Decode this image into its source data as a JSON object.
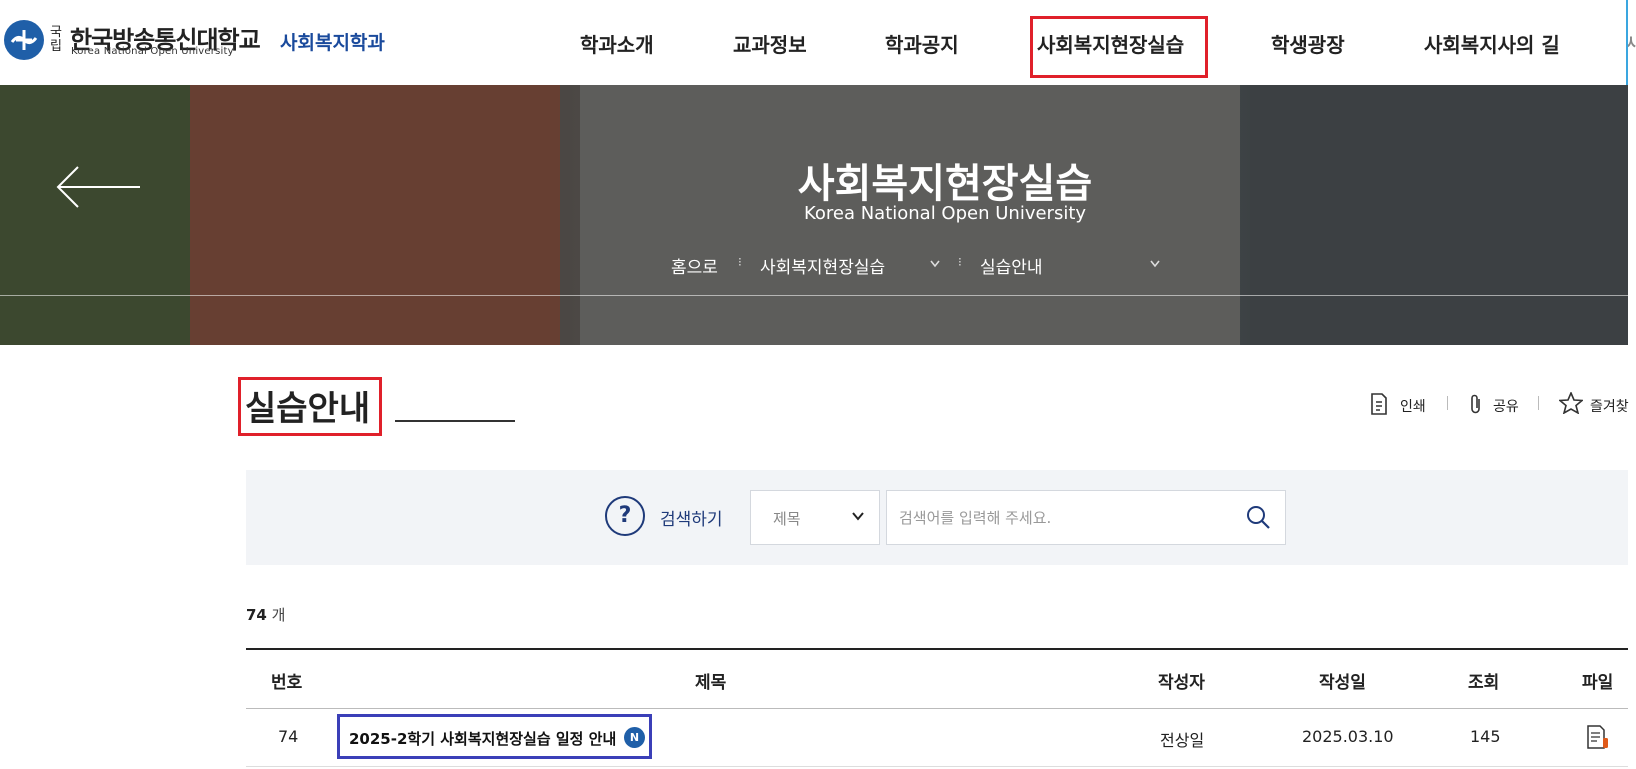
{
  "header": {
    "logo_gukrip": "국립",
    "logo_kr": "한국방송통신대학교",
    "logo_en": "Korea National Open University",
    "dept": "사회복지학과",
    "nav": [
      "학과소개",
      "교과정보",
      "학과공지",
      "사회복지현장실습",
      "학생광장",
      "사회복지사의 길"
    ],
    "nav_cut": "사"
  },
  "hero": {
    "title": "사회복지현장실습",
    "subtitle": "Korea National Open University",
    "breadcrumb": [
      "홈으로",
      "사회복지현장실습",
      "실습안내"
    ]
  },
  "page": {
    "title": "실습안내",
    "tools": {
      "print": "인쇄",
      "share": "공유",
      "favorite": "즐겨찾"
    }
  },
  "search": {
    "label": "검색하기",
    "help_symbol": "?",
    "select_value": "제목",
    "placeholder": "검색어를 입력해 주세요."
  },
  "list": {
    "count_num": "74",
    "count_unit": " 개",
    "columns": [
      "번호",
      "제목",
      "작성자",
      "작성일",
      "조회",
      "파일"
    ],
    "rows": [
      {
        "no": "74",
        "title": "2025-2학기 사회복지현장실습 일정 안내",
        "badge": "N",
        "author": "전상일",
        "date": "2025.03.10",
        "views": "145"
      }
    ]
  },
  "colors": {
    "brand_blue": "#1f5fa8",
    "highlight_red": "#e0202a",
    "highlight_blue": "#3b3fb8",
    "navy": "#1f3a7a"
  },
  "icons": [
    "knou-emblem-icon",
    "arrow-left-icon",
    "chevron-down-icon",
    "print-icon",
    "paperclip-icon",
    "star-icon",
    "help-icon",
    "search-icon",
    "file-icon"
  ]
}
